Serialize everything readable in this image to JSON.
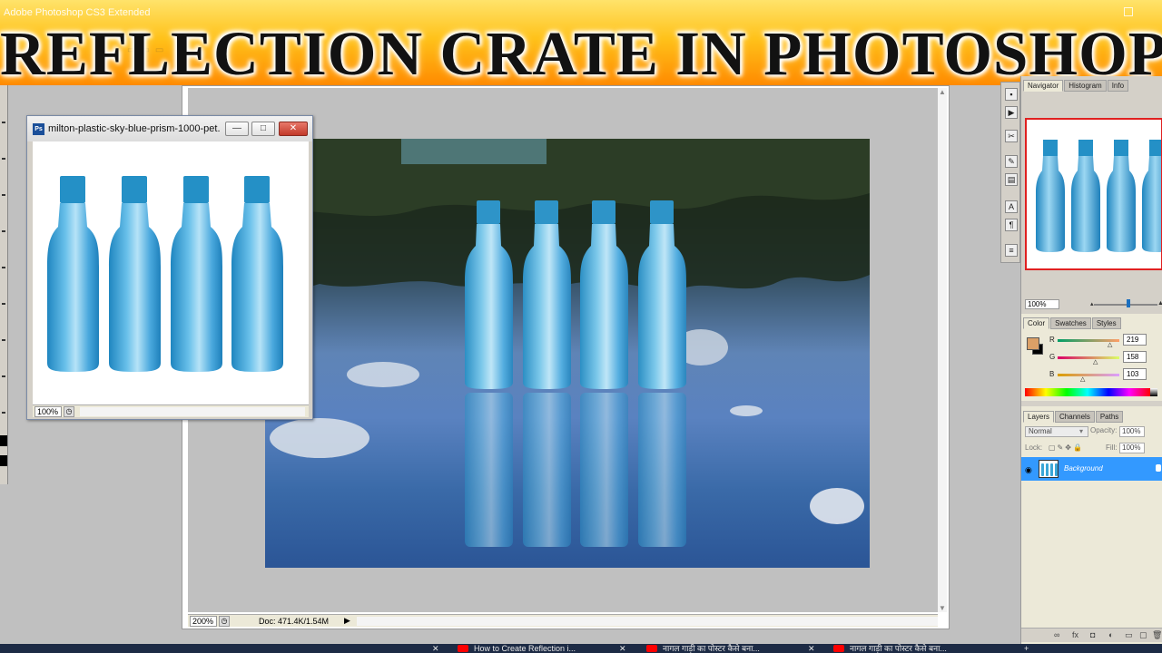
{
  "app": {
    "title": "Adobe Photoshop CS3 Extended"
  },
  "banner": {
    "title": "REFLECTION CRATE IN PHOTOSHOP"
  },
  "main_doc": {
    "zoom": "200%",
    "doc_info": "Doc: 471.4K/1.54M"
  },
  "secondary_doc": {
    "title": "milton-plastic-sky-blue-prism-1000-pet...",
    "zoom": "100%",
    "buttons": {
      "minimize": "—",
      "maximize": "□",
      "close": "✕"
    }
  },
  "navigator": {
    "tabs": [
      "Navigator",
      "Histogram",
      "Info"
    ],
    "zoom": "100%"
  },
  "color_panel": {
    "tabs": [
      "Color",
      "Swatches",
      "Styles"
    ],
    "foreground": "#dba067",
    "background": "#000000",
    "channels": [
      {
        "label": "R",
        "value": "219"
      },
      {
        "label": "G",
        "value": "158"
      },
      {
        "label": "B",
        "value": "103"
      }
    ]
  },
  "layers_panel": {
    "tabs": [
      "Layers",
      "Channels",
      "Paths"
    ],
    "blend_mode": "Normal",
    "opacity_label": "Opacity:",
    "opacity": "100%",
    "lock_label": "Lock:",
    "fill_label": "Fill:",
    "fill": "100%",
    "layers": [
      {
        "name": "Background"
      }
    ]
  },
  "taskbar": {
    "items": [
      {
        "label": "How to Create Reflection i..."
      },
      {
        "label": "नागल गाड़ी का पोस्टर कैसे बना..."
      },
      {
        "label": "नागल गाड़ी का पोस्टर कैसे बना..."
      }
    ]
  }
}
